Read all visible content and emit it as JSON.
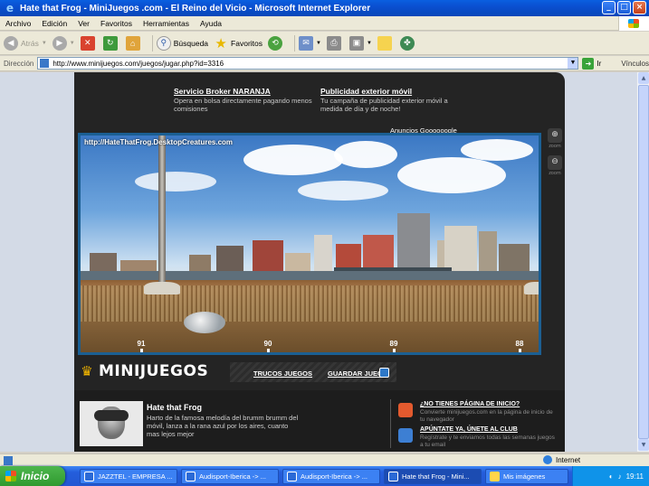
{
  "window": {
    "title": "Hate that Frog - MiniJuegos .com - El Reino del Vicio - Microsoft Internet Explorer"
  },
  "menu": [
    "Archivo",
    "Edición",
    "Ver",
    "Favoritos",
    "Herramientas",
    "Ayuda"
  ],
  "toolbar": {
    "back": "Atrás",
    "search": "Búsqueda",
    "favorites": "Favoritos"
  },
  "address": {
    "label": "Dirección",
    "url": "http://www.minijuegos.com/juegos/jugar.php?id=3316",
    "go": "Ir",
    "links": "Vínculos"
  },
  "ads": {
    "ad1_title": "Servicio Broker NARANJA",
    "ad1_text": "Opera en bolsa directamente pagando menos comisiones",
    "ad2_title": "Publicidad exterior móvil",
    "ad2_text": "Tu campaña de publicidad exterior móvil a medida de día y de noche!",
    "adsense": "Anuncios Goooooogle"
  },
  "game": {
    "overlay_url": "http://HateThatFrog.DesktopCreatures.com",
    "markers": [
      "91",
      "90",
      "89",
      "88"
    ]
  },
  "zoom": {
    "in_label": "zoom",
    "out_label": "zoom"
  },
  "brand": {
    "logo": "MINIJUEGOS",
    "trucos": "TRUCOS JUEGOS",
    "guardar": "GUARDAR JUEGO"
  },
  "info": {
    "title": "Hate that Frog",
    "description": "Harto de la famosa melodía del brumm brumm del móvil, lanza a la rana azul por los aires, cuanto mas lejos mejor"
  },
  "promos": [
    {
      "title": "¿NO TIENES PÁGINA DE INICIO?",
      "text": "Convierte minijuegos.com en la página de inicio de tu navegador"
    },
    {
      "title": "APÚNTATE YA, ÚNETE AL CLUB",
      "text": "Regístrate y te enviamos todas las semanas juegos a tu email"
    }
  ],
  "status": {
    "zone": "Internet"
  },
  "taskbar": {
    "start": "Inicio",
    "tasks": [
      "JAZZTEL - EMPRESA ...",
      "Audisport-Iberica -> ...",
      "Audisport-Iberica -> ...",
      "Hate that Frog - Mini...",
      "Mis imágenes"
    ],
    "lang": "ES",
    "clock": "19:11"
  },
  "colors": {
    "titlebar": "#0a4fd0",
    "site_bg": "#242424",
    "game_border": "#1b5f93",
    "accent_crown": "#f0b400"
  }
}
